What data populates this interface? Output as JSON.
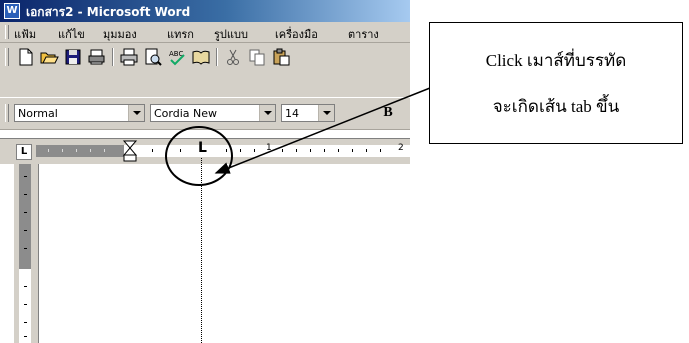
{
  "window": {
    "title": "เอกสาร2 - Microsoft Word",
    "app_icon": "word-app-icon"
  },
  "menubar": {
    "items": [
      "แฟ้ม",
      "แก้ไข",
      "มุมมอง",
      "แทรก",
      "รูปแบบ",
      "เครื่องมือ",
      "ตาราง"
    ]
  },
  "toolbar": {
    "icons": [
      "new-document-icon",
      "open-folder-icon",
      "save-icon",
      "print-preview-icon",
      "print-icon",
      "preview-icon",
      "spelling-icon",
      "research-icon",
      "cut-icon",
      "copy-icon",
      "paste-icon"
    ]
  },
  "format_bar": {
    "style_value": "Normal",
    "font_value": "Cordia New",
    "size_value": "14",
    "bold_label": "B"
  },
  "ruler": {
    "tab_selector_glyph": "L",
    "tab_marker_glyph": "L",
    "number_1": "1",
    "number_2": "2"
  },
  "callout": {
    "line1": "Click เมาส์ที่บรรทัด",
    "line2": "จะเกิดเส้น tab ขึ้น"
  },
  "colors": {
    "titlebar_start": "#0a246a",
    "titlebar_end": "#a6caf0",
    "chrome": "#d4d0c8"
  }
}
